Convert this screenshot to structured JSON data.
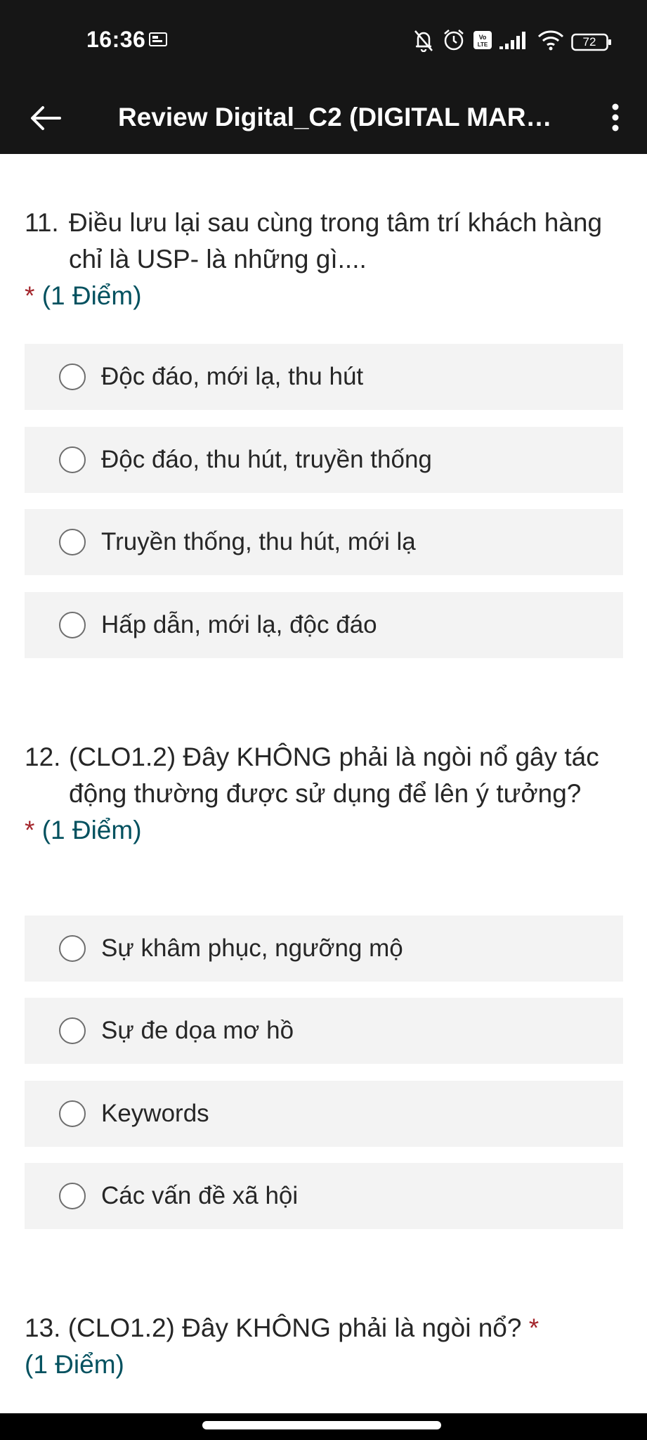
{
  "status": {
    "time": "16:36",
    "battery": "72"
  },
  "appbar": {
    "title": "Review Digital_C2 (DIGITAL MARKE..."
  },
  "questions": [
    {
      "number": "11.",
      "title": "Điều lưu lại sau cùng trong tâm trí khách hàng chỉ là USP- là những gì....",
      "required": "*",
      "points": "(1 Điểm)",
      "options": [
        "Độc đáo, mới lạ, thu hút",
        "Độc đáo, thu hút, truyền thống",
        "Truyền thống, thu hút, mới lạ",
        "Hấp dẫn, mới lạ, độc đáo"
      ]
    },
    {
      "number": "12.",
      "title": "(CLO1.2) Đây KHÔNG phải là ngòi nổ gây tác động thường được sử dụng để lên ý tưởng?",
      "required": "*",
      "points": "(1 Điểm)",
      "options": [
        "Sự khâm phục, ngưỡng mộ",
        "Sự đe dọa mơ hồ",
        "Keywords",
        "Các vấn đề xã hội"
      ]
    },
    {
      "number": "13.",
      "title": "(CLO1.2) Đây KHÔNG phải là ngòi nổ?",
      "required": "*",
      "points": "(1 Điểm)"
    }
  ],
  "colors": {
    "header_bg": "#161616",
    "option_bg": "#f3f3f3",
    "required": "#a4262c",
    "points": "#03515f"
  }
}
